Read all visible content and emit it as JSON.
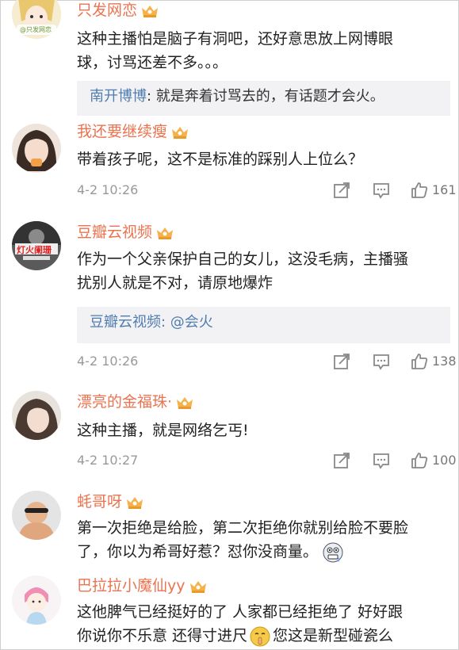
{
  "comments": [
    {
      "username": "只发网恋",
      "avatar_label": "@只发网恋",
      "text_lines": [
        "这种主播怕是脑子有洞吧，还好意思放上网博眼",
        "球，讨骂还差不多。。。"
      ],
      "reply": {
        "name": "南开博博",
        "text": ": 就是奔着讨骂去的，有话题才会火。"
      }
    },
    {
      "username": "我还要继续瘦",
      "text_lines": [
        "带着孩子呢，这不是标准的踩别人上位么？"
      ],
      "time": "4-2 10:26",
      "likes": "161"
    },
    {
      "username": "豆瓣云视频",
      "avatar_label": "灯火阑珊",
      "text_lines": [
        "作为一个父亲保护自己的女儿，这没毛病，主播骚",
        "扰别人就是不对，请原地爆炸"
      ],
      "reply": {
        "name": "豆瓣云视频",
        "text": ": @会火"
      },
      "time": "4-2 10:26",
      "likes": "138"
    },
    {
      "username": "漂亮的金福珠·",
      "text_lines": [
        "这种主播，就是网络乞丐!"
      ],
      "time": "4-2 10:27",
      "likes": "100"
    },
    {
      "username": "蚝哥呀",
      "text_lines": [
        "第一次拒绝是给脸，第二次拒绝你就别给脸不要脸",
        "了，你以为希哥好惹？怼你没商量。"
      ]
    },
    {
      "username": "巴拉拉小魔仙yy",
      "text_lines": [
        "这他脾气已经挺好的了 人家都已经拒绝了 好好跟",
        "你说你不乐意 还得寸进尺",
        "您这是新型碰瓷么"
      ]
    }
  ],
  "colors": {
    "username": "#eb7350",
    "reply_name": "#507daf",
    "meta": "#999999"
  },
  "icons": [
    "crown-badge-icon",
    "share-icon",
    "comment-icon",
    "like-icon",
    "grimace-emoji-icon",
    "shush-emoji-icon"
  ]
}
